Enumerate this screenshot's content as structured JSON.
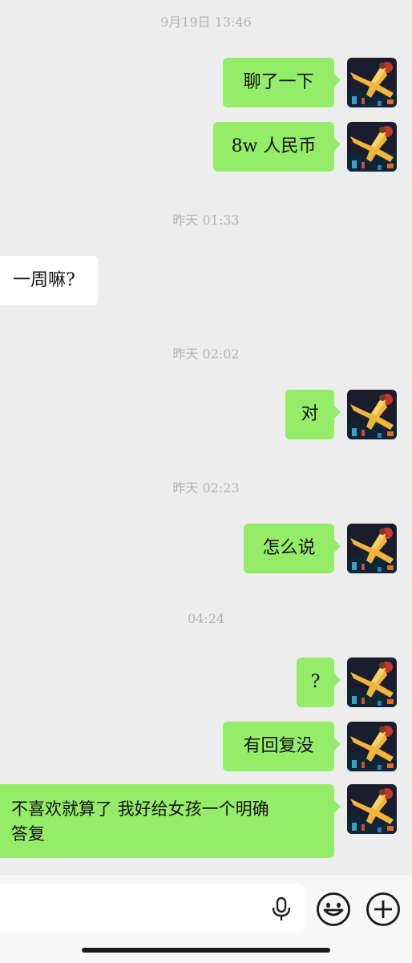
{
  "timestamps": [
    "9月19日 13:46",
    "昨天 01:33",
    "昨天 02:02",
    "昨天 02:23",
    "04:24"
  ],
  "messages": [
    {
      "sender": "me",
      "text": "聊了一下"
    },
    {
      "sender": "me",
      "text": "8w 人民币"
    },
    {
      "sender": "them",
      "text": "一周嘛?"
    },
    {
      "sender": "me",
      "text": "对"
    },
    {
      "sender": "me",
      "text": "怎么说"
    },
    {
      "sender": "me",
      "text": "?"
    },
    {
      "sender": "me",
      "text": "有回复没"
    },
    {
      "sender": "me",
      "text_line1": "不喜欢就算了 我好给女孩一个明确",
      "text_line2": "答复"
    }
  ],
  "input_bar": {
    "icons": [
      "microphone-icon",
      "emoji-icon",
      "plus-icon"
    ]
  },
  "colors": {
    "background": "#ededed",
    "my_bubble": "#95ec69",
    "their_bubble": "#ffffff",
    "timestamp_text": "#b2b2b2"
  }
}
